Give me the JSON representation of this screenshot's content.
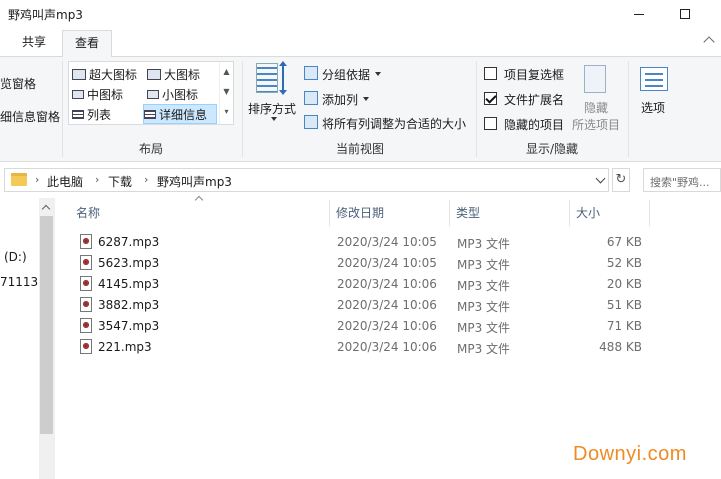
{
  "window": {
    "title": "野鸡叫声mp3"
  },
  "tabs": [
    {
      "label": "共享"
    },
    {
      "label": "查看"
    }
  ],
  "ribbon": {
    "pane_cut_labels": [
      "览窗格",
      "细信息窗格"
    ],
    "layout": {
      "group_label": "布局",
      "items": [
        {
          "label": "超大图标"
        },
        {
          "label": "大图标"
        },
        {
          "label": "中图标"
        },
        {
          "label": "小图标"
        },
        {
          "label": "列表"
        },
        {
          "label": "详细信息"
        }
      ]
    },
    "current_view": {
      "group_label": "当前视图",
      "sort_label": "排序方式",
      "group_by": "分组依据",
      "add_column": "添加列",
      "fit_columns": "将所有列调整为合适的大小"
    },
    "show_hide": {
      "group_label": "显示/隐藏",
      "item_checkboxes": "项目复选框",
      "file_extensions": "文件扩展名",
      "hidden_items": "隐藏的项目",
      "hide_label_1": "隐藏",
      "hide_label_2": "所选项目"
    },
    "options_label": "选项"
  },
  "address": {
    "crumbs": [
      "此电脑",
      "下载",
      "野鸡叫声mp3"
    ],
    "search_placeholder": "搜索\"野鸡..."
  },
  "nav": {
    "items": [
      "(D:)",
      "71113"
    ]
  },
  "columns": {
    "name": "名称",
    "date": "修改日期",
    "type": "类型",
    "size": "大小"
  },
  "files": [
    {
      "name": "6287.mp3",
      "date": "2020/3/24 10:05",
      "type": "MP3 文件",
      "size": "67 KB"
    },
    {
      "name": "5623.mp3",
      "date": "2020/3/24 10:05",
      "type": "MP3 文件",
      "size": "52 KB"
    },
    {
      "name": "4145.mp3",
      "date": "2020/3/24 10:06",
      "type": "MP3 文件",
      "size": "20 KB"
    },
    {
      "name": "3882.mp3",
      "date": "2020/3/24 10:06",
      "type": "MP3 文件",
      "size": "51 KB"
    },
    {
      "name": "3547.mp3",
      "date": "2020/3/24 10:06",
      "type": "MP3 文件",
      "size": "71 KB"
    },
    {
      "name": "221.mp3",
      "date": "2020/3/24 10:06",
      "type": "MP3 文件",
      "size": "488 KB"
    }
  ],
  "watermark": "Downyi.com"
}
